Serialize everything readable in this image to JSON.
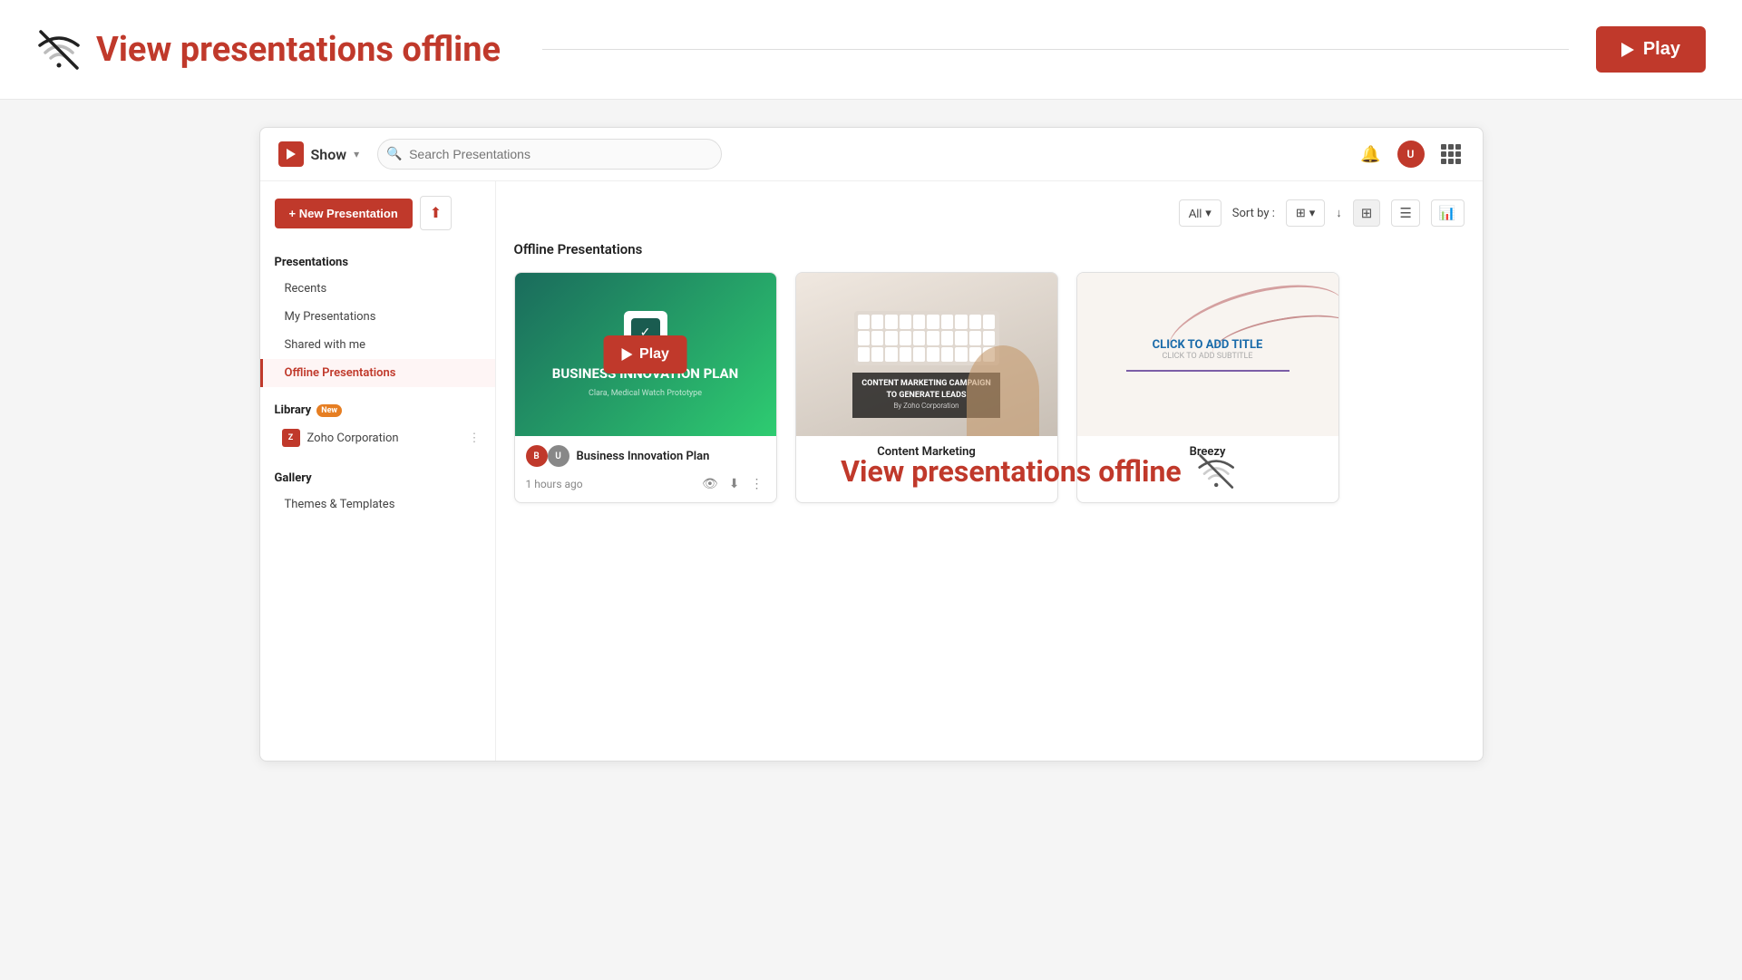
{
  "topBar": {
    "title": "View presentations ",
    "titleHighlight": "offline",
    "playLabel": "Play",
    "dividerVisible": true
  },
  "app": {
    "headerLogo": "Show",
    "searchPlaceholder": "Search Presentations",
    "header": {
      "logoText": "Show",
      "chevron": "▾",
      "notificationIcon": "🔔",
      "gridIcon": "grid",
      "avatarLabel": "U"
    }
  },
  "sidebar": {
    "newButton": "+ New Presentation",
    "uploadIcon": "⬆",
    "presentationsSection": "Presentations",
    "items": [
      {
        "label": "Recents",
        "active": false
      },
      {
        "label": "My Presentations",
        "active": false
      },
      {
        "label": "Shared with me",
        "active": false
      },
      {
        "label": "Offline Presentations",
        "active": true
      }
    ],
    "librarySection": "Library",
    "libraryBadge": "New",
    "zohoLabel": "Zoho Corporation",
    "gallerySection": "Gallery",
    "galleryItems": [
      {
        "label": "Themes & Templates",
        "active": false
      }
    ]
  },
  "mainContent": {
    "sectionTitle": "Offline Presentations",
    "offlineOverlayText": "View presentations ",
    "offlineOverlayHighlight": "offline",
    "toolbar": {
      "filterLabel": "All",
      "sortLabel": "Sort by :",
      "sortValue": "grid",
      "viewGrid": "⊞",
      "viewList": "☰",
      "viewChart": "📊"
    },
    "presentations": [
      {
        "id": "bip",
        "title": "Business Innovation Plan",
        "time": "1 hours ago",
        "thumbType": "bip",
        "bipTitle": "BUSINESS INNOVATION PLAN",
        "bipSub": "Clara, Medical Watch Prototype",
        "hasAvatar": true,
        "avatarLabel": "B",
        "showPlayOverlay": true
      },
      {
        "id": "cm",
        "title": "Content Marketing",
        "time": "",
        "thumbType": "cm",
        "cmOverlayText": "CONTENT MARKETING CAMPAIGN\nTO GENERATE LEADS",
        "hasAvatar": false,
        "showPlayOverlay": false
      },
      {
        "id": "breezy",
        "title": "Breezy",
        "time": "",
        "thumbType": "breezy",
        "breezyClickText": "CLICK TO ADD TITLE",
        "breezySubText": "CLICK TO ADD SUBTITLE",
        "hasAvatar": false,
        "showPlayOverlay": false
      }
    ]
  }
}
